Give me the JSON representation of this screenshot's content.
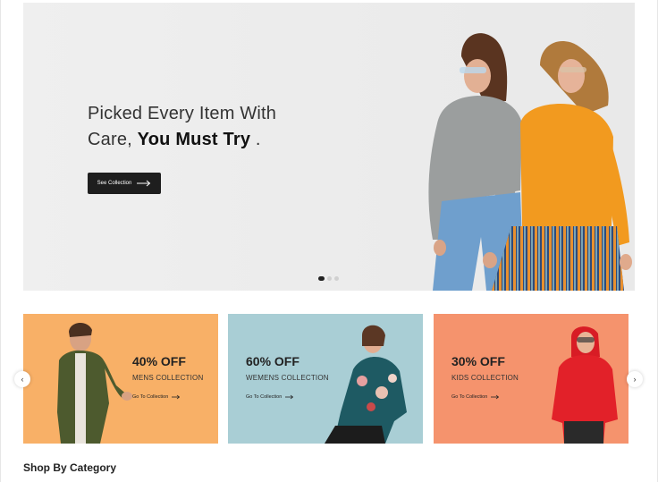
{
  "hero": {
    "title_line1": "Picked Every Item With",
    "title_line2_prefix": "Care, ",
    "title_line2_emphasis": "You Must Try",
    "title_line2_suffix": " .",
    "button_label": "See Collection",
    "slide_count": 3,
    "active_slide": 1,
    "background": "#ececec",
    "button_color": "#1e1e1e"
  },
  "banners": [
    {
      "discount": "40% OFF",
      "collection": "MENS COLLECTION",
      "link": "Go To Collection",
      "bg": "#f8b067"
    },
    {
      "discount": "60% OFF",
      "collection": "WEMENS COLLECTION",
      "link": "Go To Collection",
      "bg": "#a9ced5"
    },
    {
      "discount": "30% OFF",
      "collection": "KIDS COLLECTION",
      "link": "Go To Collection",
      "bg": "#f5936d"
    }
  ],
  "carousel": {
    "prev_icon": "chevron-left-icon",
    "next_icon": "chevron-right-icon",
    "prev_glyph": "‹",
    "next_glyph": "›"
  },
  "section": {
    "title": "Shop By Category"
  }
}
